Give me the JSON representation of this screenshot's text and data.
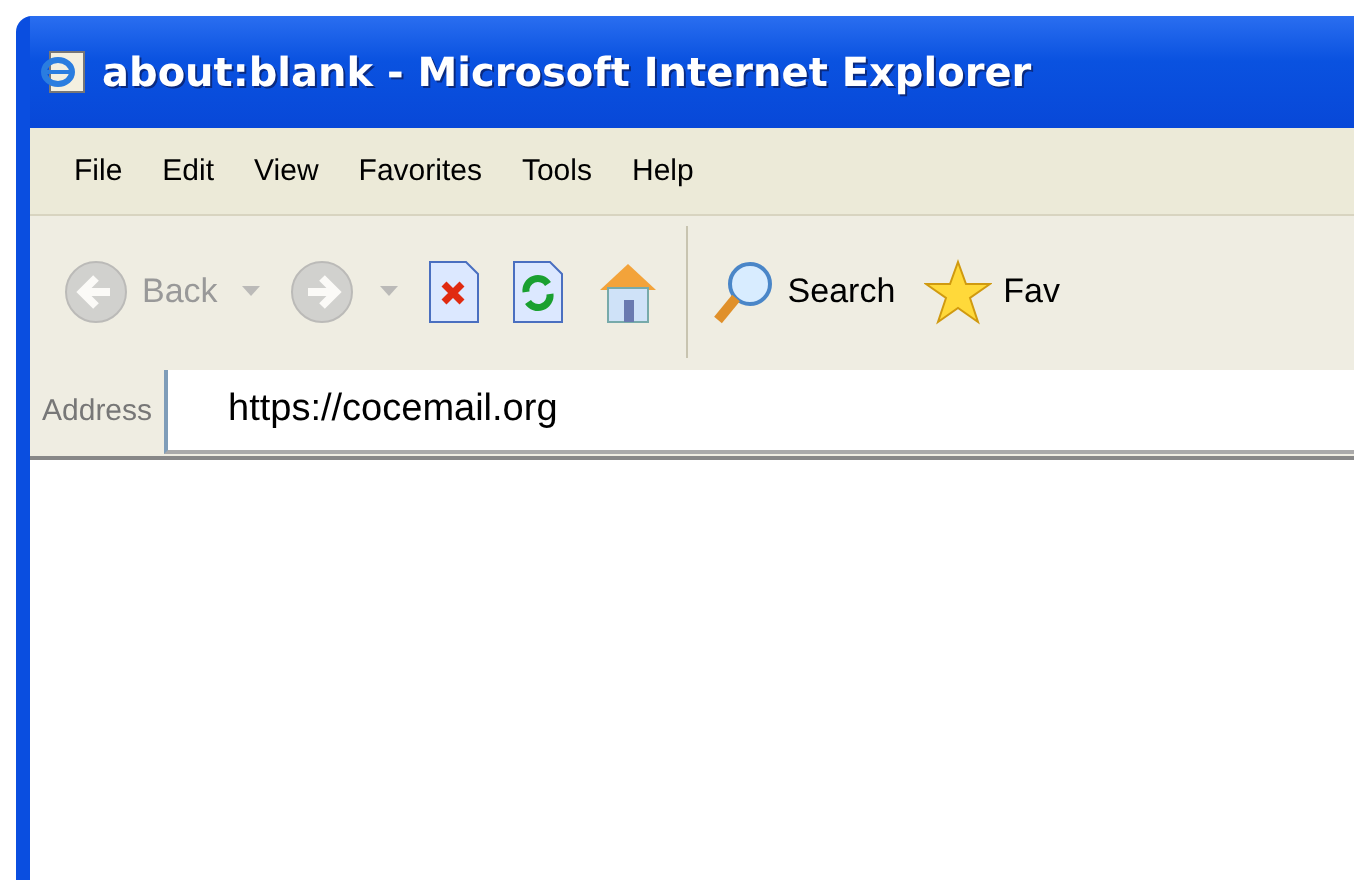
{
  "window": {
    "title": "about:blank - Microsoft Internet Explorer"
  },
  "menu": [
    {
      "label": "File"
    },
    {
      "label": "Edit"
    },
    {
      "label": "View"
    },
    {
      "label": "Favorites"
    },
    {
      "label": "Tools"
    },
    {
      "label": "Help"
    }
  ],
  "toolbar": [
    {
      "kind": "back",
      "label": "Back",
      "disabled": true
    },
    {
      "kind": "forward",
      "disabled": true
    },
    {
      "kind": "stop",
      "disabled": false
    },
    {
      "kind": "refresh",
      "disabled": false
    },
    {
      "kind": "home",
      "disabled": false
    },
    {
      "kind": "search",
      "label": "Search",
      "disabled": false
    },
    {
      "kind": "favorites",
      "label": "Fav",
      "disabled": false
    }
  ],
  "address": {
    "label": "Address",
    "value": "https://cocemail.org"
  }
}
